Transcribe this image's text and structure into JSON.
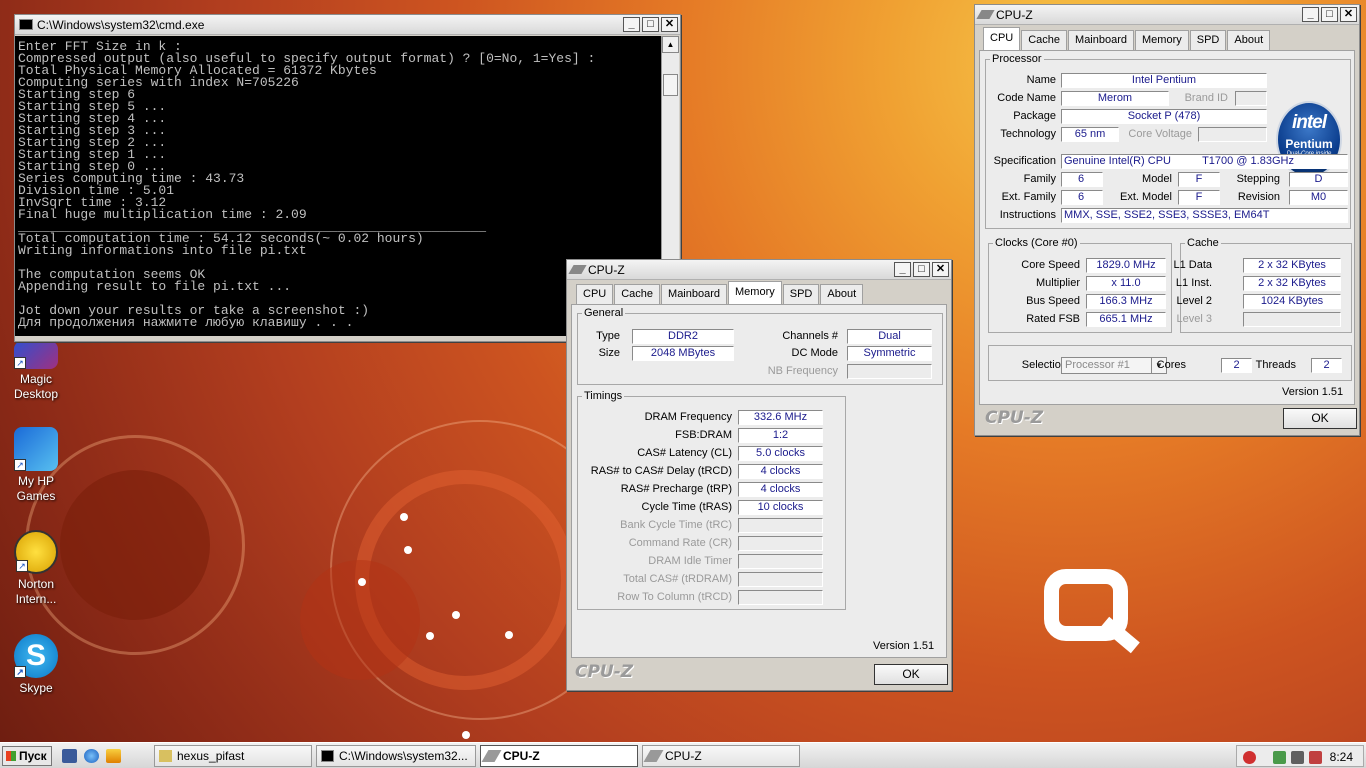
{
  "desktop": {
    "icons": [
      {
        "label": "Magic Desktop"
      },
      {
        "label": "My HP Games"
      },
      {
        "label": "Norton Intern..."
      },
      {
        "label": "Skype"
      }
    ]
  },
  "cmd": {
    "title": "C:\\Windows\\system32\\cmd.exe",
    "lines": [
      "Enter FFT Size in k :",
      "Compressed output (also useful to specify output format) ? [0=No, 1=Yes] :",
      "Total Physical Memory Allocated = 61372 Kbytes",
      "Computing series with index N=705226",
      "Starting step 6",
      "Starting step 5 ...",
      "Starting step 4 ...",
      "Starting step 3 ...",
      "Starting step 2 ...",
      "Starting step 1 ...",
      "Starting step 0 ...",
      "Series computing time : 43.73",
      "Division time : 5.01",
      "InvSqrt time : 3.12",
      "Final huge multiplication time : 2.09",
      "____________________________________________________________",
      "Total computation time : 54.12 seconds(~ 0.02 hours)",
      "Writing informations into file pi.txt",
      "",
      "The computation seems OK",
      "Appending result to file pi.txt ...",
      "",
      "Jot down your results or take a screenshot :)",
      "Для продолжения нажмите любую клавишу . . ."
    ]
  },
  "cpuz_mem": {
    "title": "CPU-Z",
    "tabs": [
      "CPU",
      "Cache",
      "Mainboard",
      "Memory",
      "SPD",
      "About"
    ],
    "active_tab": "Memory",
    "general": {
      "legend": "General",
      "type_label": "Type",
      "type": "DDR2",
      "size_label": "Size",
      "size": "2048 MBytes",
      "channels_label": "Channels #",
      "channels": "Dual",
      "dcmode_label": "DC Mode",
      "dcmode": "Symmetric",
      "nbfreq_label": "NB Frequency",
      "nbfreq": ""
    },
    "timings": {
      "legend": "Timings",
      "rows": [
        {
          "label": "DRAM Frequency",
          "value": "332.6 MHz",
          "dim": false
        },
        {
          "label": "FSB:DRAM",
          "value": "1:2",
          "dim": false
        },
        {
          "label": "CAS# Latency (CL)",
          "value": "5.0 clocks",
          "dim": false
        },
        {
          "label": "RAS# to CAS# Delay (tRCD)",
          "value": "4 clocks",
          "dim": false
        },
        {
          "label": "RAS# Precharge (tRP)",
          "value": "4 clocks",
          "dim": false
        },
        {
          "label": "Cycle Time (tRAS)",
          "value": "10 clocks",
          "dim": false
        },
        {
          "label": "Bank Cycle Time (tRC)",
          "value": "",
          "dim": true
        },
        {
          "label": "Command Rate (CR)",
          "value": "",
          "dim": true
        },
        {
          "label": "DRAM Idle Timer",
          "value": "",
          "dim": true
        },
        {
          "label": "Total CAS# (tRDRAM)",
          "value": "",
          "dim": true
        },
        {
          "label": "Row To Column (tRCD)",
          "value": "",
          "dim": true
        }
      ]
    },
    "version": "Version 1.51",
    "logo": "CPU-Z",
    "ok": "OK"
  },
  "cpuz_cpu": {
    "title": "CPU-Z",
    "tabs": [
      "CPU",
      "Cache",
      "Mainboard",
      "Memory",
      "SPD",
      "About"
    ],
    "active_tab": "CPU",
    "processor": {
      "legend": "Processor",
      "name_label": "Name",
      "name": "Intel Pentium",
      "codename_label": "Code Name",
      "codename": "Merom",
      "brandid_label": "Brand ID",
      "brandid": "",
      "package_label": "Package",
      "package": "Socket P (478)",
      "technology_label": "Technology",
      "technology": "65 nm",
      "corevoltage_label": "Core Voltage",
      "corevoltage": "",
      "spec_label": "Specification",
      "spec_a": "Genuine Intel(R) CPU",
      "spec_b": "T1700  @ 1.83GHz",
      "family_label": "Family",
      "family": "6",
      "model_label": "Model",
      "model": "F",
      "stepping_label": "Stepping",
      "stepping": "D",
      "extfamily_label": "Ext. Family",
      "extfamily": "6",
      "extmodel_label": "Ext. Model",
      "extmodel": "F",
      "revision_label": "Revision",
      "revision": "M0",
      "instructions_label": "Instructions",
      "instructions": "MMX, SSE, SSE2, SSE3, SSSE3, EM64T"
    },
    "intel_logo": {
      "brand": "intel",
      "line": "Pentium",
      "sub": "Dual-Core inside"
    },
    "clocks": {
      "legend": "Clocks (Core #0)",
      "corespeed_label": "Core Speed",
      "corespeed": "1829.0 MHz",
      "multiplier_label": "Multiplier",
      "multiplier": "x 11.0",
      "busspeed_label": "Bus Speed",
      "busspeed": "166.3 MHz",
      "ratedfsb_label": "Rated FSB",
      "ratedfsb": "665.1 MHz"
    },
    "cache": {
      "legend": "Cache",
      "l1data_label": "L1 Data",
      "l1data": "2 x 32 KBytes",
      "l1inst_label": "L1 Inst.",
      "l1inst": "2 x 32 KBytes",
      "level2_label": "Level 2",
      "level2": "1024 KBytes",
      "level3_label": "Level 3",
      "level3": ""
    },
    "selection_label": "Selection",
    "selection": "Processor #1",
    "cores_label": "Cores",
    "cores": "2",
    "threads_label": "Threads",
    "threads": "2",
    "version": "Version 1.51",
    "logo": "CPU-Z",
    "ok": "OK"
  },
  "taskbar": {
    "start": "Пуск",
    "buttons": [
      {
        "label": "hexus_pifast"
      },
      {
        "label": "C:\\Windows\\system32..."
      },
      {
        "label": "CPU-Z"
      },
      {
        "label": "CPU-Z"
      }
    ],
    "clock": "8:24"
  },
  "colors": {
    "value_text": "#1a1a8c",
    "console_bg": "#000000",
    "console_text": "#c0c0c0"
  }
}
